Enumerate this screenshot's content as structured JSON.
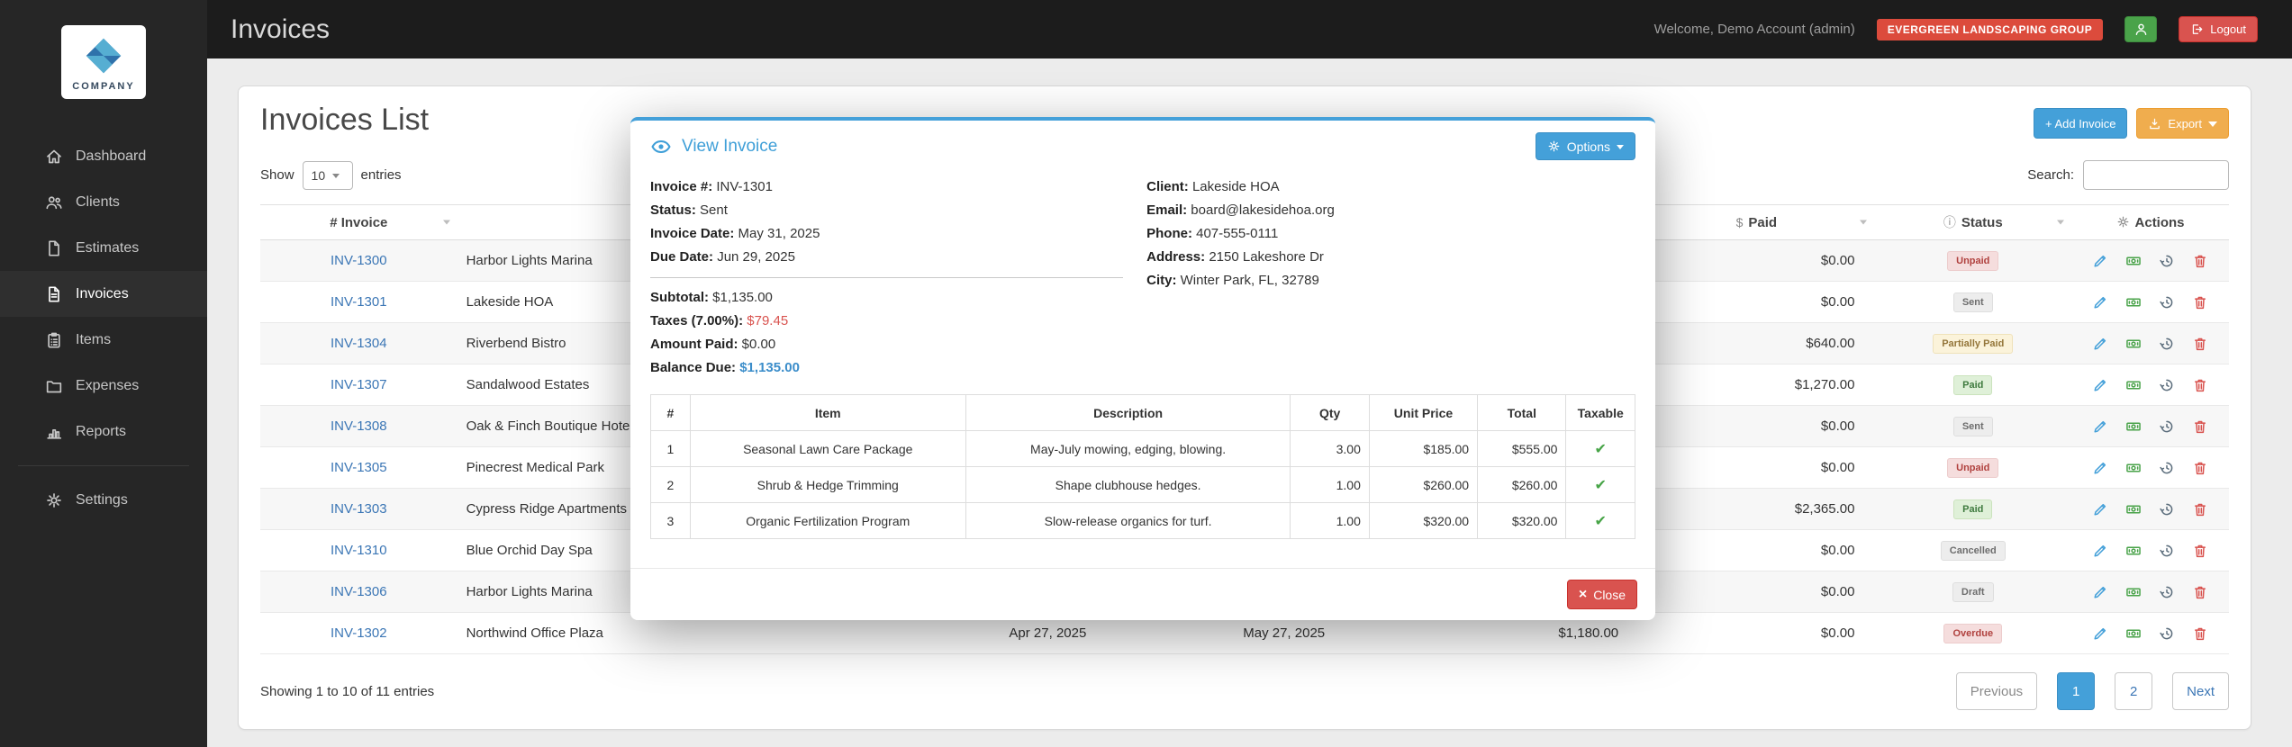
{
  "topbar": {
    "title": "Invoices",
    "welcome": "Welcome, Demo Account (admin)",
    "org_badge": "EVERGREEN LANDSCAPING GROUP",
    "logout_label": "Logout"
  },
  "sidebar": {
    "logo_text": "COMPANY",
    "items": [
      {
        "label": "Dashboard"
      },
      {
        "label": "Clients"
      },
      {
        "label": "Estimates"
      },
      {
        "label": "Invoices"
      },
      {
        "label": "Items"
      },
      {
        "label": "Expenses"
      },
      {
        "label": "Reports"
      },
      {
        "label": "Settings"
      }
    ]
  },
  "page": {
    "heading": "Invoices List",
    "add_invoice_label": "+ Add Invoice",
    "export_label": "Export",
    "show_label": "Show",
    "page_length": "10",
    "entries_label": "entries",
    "search_label": "Search:",
    "table_headers": {
      "invoice": "# Invoice",
      "client": "",
      "invoice_date": "",
      "due_date": "",
      "total": "",
      "paid": "Paid",
      "paid_icon": "$",
      "status": "Status",
      "actions": "Actions"
    },
    "rows": [
      {
        "invoice": "INV-1300",
        "client": "Harbor Lights Marina",
        "invoice_date": "",
        "due_date": "",
        "total": "",
        "paid": "$0.00",
        "status": "Unpaid"
      },
      {
        "invoice": "INV-1301",
        "client": "Lakeside HOA",
        "invoice_date": "",
        "due_date": "",
        "total": "",
        "paid": "$0.00",
        "status": "Sent"
      },
      {
        "invoice": "INV-1304",
        "client": "Riverbend Bistro",
        "invoice_date": "",
        "due_date": "",
        "total": "",
        "paid": "$640.00",
        "status": "Partially Paid"
      },
      {
        "invoice": "INV-1307",
        "client": "Sandalwood Estates",
        "invoice_date": "",
        "due_date": "",
        "total": "",
        "paid": "$1,270.00",
        "status": "Paid"
      },
      {
        "invoice": "INV-1308",
        "client": "Oak & Finch Boutique Hotel",
        "invoice_date": "",
        "due_date": "",
        "total": "",
        "paid": "$0.00",
        "status": "Sent"
      },
      {
        "invoice": "INV-1305",
        "client": "Pinecrest Medical Park",
        "invoice_date": "",
        "due_date": "",
        "total": "",
        "paid": "$0.00",
        "status": "Unpaid"
      },
      {
        "invoice": "INV-1303",
        "client": "Cypress Ridge Apartments",
        "invoice_date": "",
        "due_date": "",
        "total": "",
        "paid": "$2,365.00",
        "status": "Paid"
      },
      {
        "invoice": "INV-1310",
        "client": "Blue Orchid Day Spa",
        "invoice_date": "",
        "due_date": "",
        "total": "",
        "paid": "$0.00",
        "status": "Cancelled"
      },
      {
        "invoice": "INV-1306",
        "client": "Harbor Lights Marina",
        "invoice_date": "",
        "due_date": "",
        "total": "",
        "paid": "$0.00",
        "status": "Draft"
      },
      {
        "invoice": "INV-1302",
        "client": "Northwind Office Plaza",
        "invoice_date": "Apr 27, 2025",
        "due_date": "May 27, 2025",
        "total": "$1,180.00",
        "paid": "$0.00",
        "status": "Overdue"
      }
    ],
    "info_text": "Showing 1 to 10 of 11 entries",
    "pagination": {
      "previous": "Previous",
      "page1": "1",
      "page2": "2",
      "next": "Next"
    }
  },
  "modal": {
    "title": "View Invoice",
    "options_label": "Options",
    "details": [
      {
        "label": "Invoice #:",
        "value": "INV-1301"
      },
      {
        "label": "Status:",
        "value": "Sent"
      },
      {
        "label": "Invoice Date:",
        "value": "May 31, 2025"
      },
      {
        "label": "Due Date:",
        "value": "Jun 29, 2025"
      }
    ],
    "client_details": [
      {
        "label": "Client:",
        "value": "Lakeside HOA"
      },
      {
        "label": "Email:",
        "value": "board@lakesidehoa.org"
      },
      {
        "label": "Phone:",
        "value": "407-555-0111"
      },
      {
        "label": "Address:",
        "value": "2150 Lakeshore Dr"
      },
      {
        "label": "City:",
        "value": "Winter Park, FL, 32789"
      }
    ],
    "summary": [
      {
        "label": "Subtotal:",
        "value": "$1,135.00"
      },
      {
        "label": "Taxes (7.00%):",
        "value": "$79.45"
      },
      {
        "label": "Amount Paid:",
        "value": "$0.00"
      },
      {
        "label": "Balance Due:",
        "value": "$1,135.00"
      }
    ],
    "items_headers": [
      "#",
      "Item",
      "Description",
      "Qty",
      "Unit Price",
      "Total",
      "Taxable"
    ],
    "items": [
      {
        "num": "1",
        "item": "Seasonal Lawn Care Package",
        "description": "May-July mowing, edging, blowing.",
        "qty": "3.00",
        "unit_price": "$185.00",
        "total": "$555.00"
      },
      {
        "num": "2",
        "item": "Shrub & Hedge Trimming",
        "description": "Shape clubhouse hedges.",
        "qty": "1.00",
        "unit_price": "$260.00",
        "total": "$260.00"
      },
      {
        "num": "3",
        "item": "Organic Fertilization Program",
        "description": "Slow-release organics for turf.",
        "qty": "1.00",
        "unit_price": "$320.00",
        "total": "$320.00"
      }
    ],
    "close_label": "Close"
  },
  "colors": {
    "accent_blue": "#44a0d9",
    "export_orange": "#f0ad4e",
    "danger_red": "#d9534f",
    "success_green": "#4aa34a",
    "sidebar_bg": "#262626",
    "topbar_bg": "#1c1c1c"
  }
}
